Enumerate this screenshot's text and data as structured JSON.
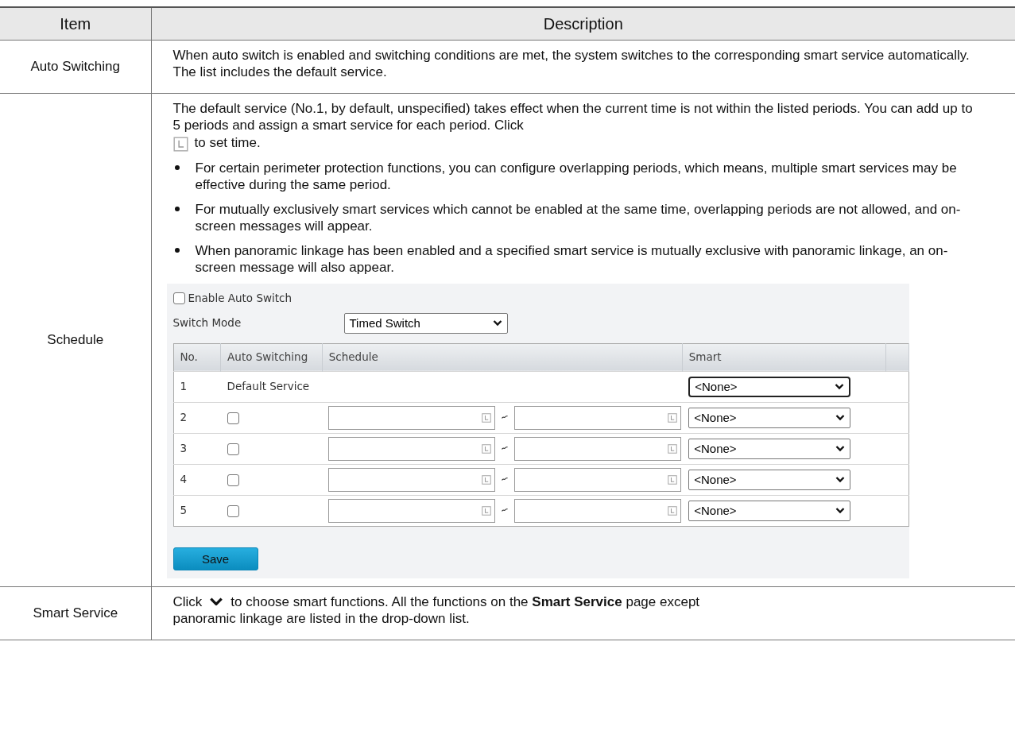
{
  "table": {
    "columns": [
      "Item",
      "Description"
    ],
    "rows": [
      {
        "item": "Auto Switching",
        "content": [
          {
            "kind": "paragraph",
            "lines": [
              [
                {
                  "kind": "text",
                  "text": "When auto switch is enabled and switching conditions are met, the system switches to the corresponding smart service automatically. The list includes the default service."
                }
              ]
            ]
          }
        ]
      },
      {
        "item": "Schedule",
        "content": [
          {
            "kind": "paragraph",
            "lines": [
              [
                {
                  "kind": "text",
                  "text": "The default service (No.1, by default, unspecified) takes effect when the current time is not within the listed periods. You can add up to 5 periods and assign a smart service for each period. Click"
                }
              ],
              [
                {
                  "kind": "picker"
                },
                {
                  "kind": "text",
                  "text": "to set time."
                }
              ]
            ]
          },
          {
            "kind": "bullets",
            "items": [
              "For certain perimeter protection functions, you can configure overlapping periods, which means, multiple smart services may be effective during the same period.",
              "For mutually exclusively smart services which cannot be enabled at the same time, overlapping periods are not allowed, and on-screen messages will appear.",
              "When panoramic linkage has been enabled and a specified smart service is mutually exclusive with panoramic linkage, an on-screen message will also appear."
            ]
          },
          {
            "kind": "screenshot",
            "enable": {
              "label": "Enable Auto Switch",
              "checked": false
            },
            "switch_mode": {
              "label": "Switch Mode",
              "value": "Timed Switch"
            },
            "columns": [
              "No.",
              "Auto Switching",
              "Schedule",
              "Smart"
            ],
            "rows": [
              {
                "no": "1",
                "kind": "default",
                "label": "Default Service",
                "smart": "<None>",
                "focused": true
              },
              {
                "no": "2",
                "kind": "period",
                "checked": false,
                "smart": "<None>",
                "focused": false
              },
              {
                "no": "3",
                "kind": "period",
                "checked": false,
                "smart": "<None>",
                "focused": false
              },
              {
                "no": "4",
                "kind": "period",
                "checked": false,
                "smart": "<None>",
                "focused": false
              },
              {
                "no": "5",
                "kind": "period",
                "checked": false,
                "smart": "<None>",
                "focused": false
              }
            ],
            "save": "Save"
          }
        ]
      },
      {
        "item": "Smart Service",
        "content": [
          {
            "kind": "paragraph",
            "lines": [
              [
                {
                  "kind": "text",
                  "text": "Click"
                },
                {
                  "kind": "dropdown"
                },
                {
                  "kind": "text",
                  "text": "to choose smart functions. All the functions on the **Smart Service** page except"
                }
              ],
              [
                {
                  "kind": "text",
                  "text": "panoramic linkage are listed in the drop-down list."
                }
              ]
            ]
          }
        ]
      }
    ]
  }
}
